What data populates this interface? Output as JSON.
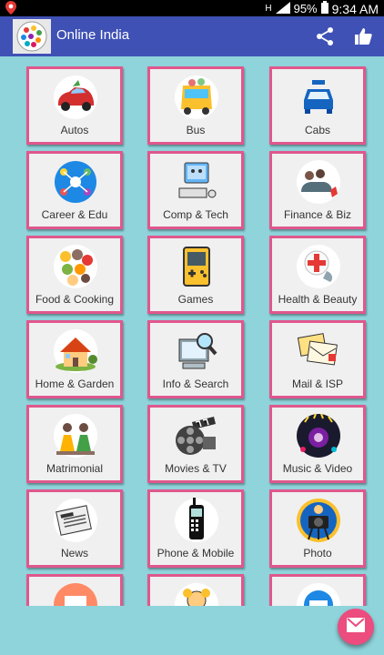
{
  "status_bar": {
    "battery": "95%",
    "time": "9:34 AM",
    "network": "H"
  },
  "app_bar": {
    "title": "Online India",
    "share_icon": "share-icon",
    "like_icon": "thumbs-up-icon"
  },
  "categories": [
    {
      "label": "Autos",
      "icon": "car-icon"
    },
    {
      "label": "Bus",
      "icon": "bus-icon"
    },
    {
      "label": "Cabs",
      "icon": "taxi-icon"
    },
    {
      "label": "Career & Edu",
      "icon": "career-icon"
    },
    {
      "label": "Comp & Tech",
      "icon": "computer-icon"
    },
    {
      "label": "Finance & Biz",
      "icon": "finance-icon"
    },
    {
      "label": "Food & Cooking",
      "icon": "food-icon"
    },
    {
      "label": "Games",
      "icon": "gameboy-icon"
    },
    {
      "label": "Health & Beauty",
      "icon": "health-icon"
    },
    {
      "label": "Home & Garden",
      "icon": "house-icon"
    },
    {
      "label": "Info & Search",
      "icon": "search-computer-icon"
    },
    {
      "label": "Mail & ISP",
      "icon": "mail-icon"
    },
    {
      "label": "Matrimonial",
      "icon": "wedding-icon"
    },
    {
      "label": "Movies & TV",
      "icon": "film-reel-icon"
    },
    {
      "label": "Music & Video",
      "icon": "music-icon"
    },
    {
      "label": "News",
      "icon": "newspaper-icon"
    },
    {
      "label": "Phone & Mobile",
      "icon": "phone-icon"
    },
    {
      "label": "Photo",
      "icon": "camera-icon"
    },
    {
      "label": "",
      "icon": "tile-icon-1"
    },
    {
      "label": "",
      "icon": "tile-icon-2"
    },
    {
      "label": "",
      "icon": "tile-icon-3"
    }
  ],
  "fab": {
    "icon": "mail-envelope-icon"
  },
  "colors": {
    "app_bar": "#3f51b5",
    "background": "#8fd3db",
    "tile_border": "#e0578d",
    "fab": "#ec4c7e"
  }
}
